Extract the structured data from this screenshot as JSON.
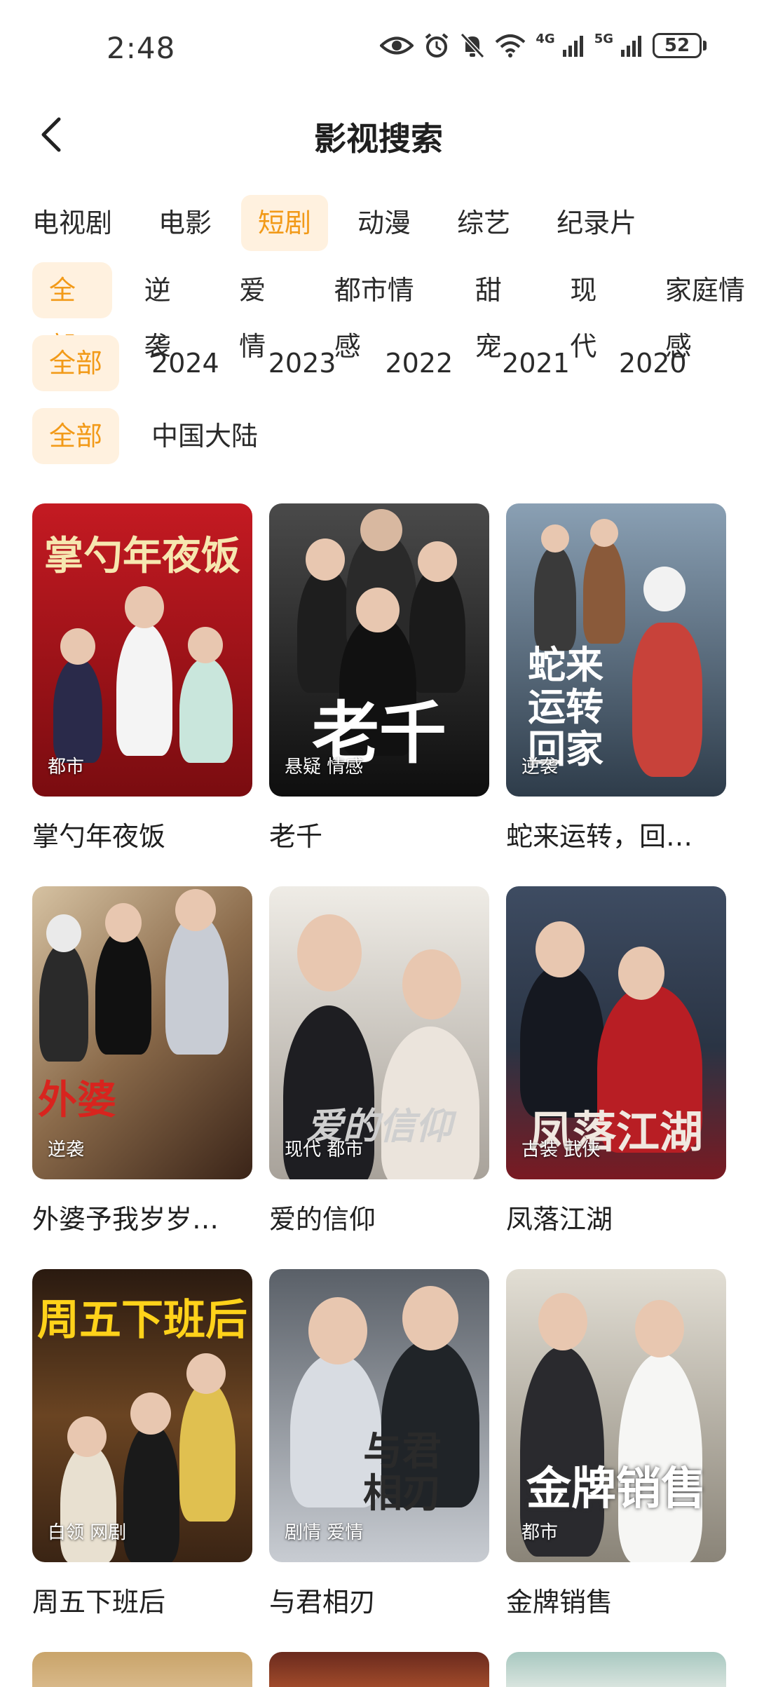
{
  "status": {
    "time": "2:48",
    "battery": "52",
    "net1": "4G",
    "net2": "5G"
  },
  "header": {
    "title": "影视搜索"
  },
  "categories": [
    "电视剧",
    "电影",
    "短剧",
    "动漫",
    "综艺",
    "纪录片"
  ],
  "active_category": "短剧",
  "filters": {
    "genre": [
      "全部",
      "逆袭",
      "爱情",
      "都市情感",
      "甜宠",
      "现代",
      "家庭情感"
    ],
    "year": [
      "全部",
      "2024",
      "2023",
      "2022",
      "2021",
      "2020"
    ],
    "region": [
      "全部",
      "中国大陆"
    ]
  },
  "items": [
    {
      "title": "掌勺年夜饭",
      "tag": "都市",
      "poster_text": "掌勺年夜饭",
      "color_top": "#b8151c",
      "color_bottom": "#6b0a0c"
    },
    {
      "title": "老千",
      "tag": "悬疑 情感",
      "poster_text": "老千",
      "color_top": "#3b3b3b",
      "color_bottom": "#101010"
    },
    {
      "title": "蛇来运转，回…",
      "tag": "逆袭",
      "poster_text": "蛇来运转回家",
      "color_top": "#7a8da0",
      "color_bottom": "#3a4a5a"
    },
    {
      "title": "外婆予我岁岁…",
      "tag": "逆袭",
      "poster_text": "外婆",
      "color_top": "#8a6a4a",
      "color_bottom": "#4a2a1a"
    },
    {
      "title": "爱的信仰",
      "tag": "现代 都市",
      "poster_text": "爱的信仰",
      "color_top": "#e6e2dc",
      "color_bottom": "#9a948c"
    },
    {
      "title": "凤落江湖",
      "tag": "古装 武侠",
      "poster_text": "凤落江湖",
      "color_top": "#4a5a70",
      "color_bottom": "#7a1a20"
    },
    {
      "title": "周五下班后",
      "tag": "白领 网剧",
      "poster_text": "周五下班后",
      "color_top": "#3a2414",
      "color_bottom": "#8a5a2a"
    },
    {
      "title": "与君相刃",
      "tag": "剧情 爱情",
      "poster_text": "与君相刃",
      "color_top": "#6a7078",
      "color_bottom": "#c8ccd0"
    },
    {
      "title": "金牌销售",
      "tag": "都市",
      "poster_text": "金牌销售",
      "color_top": "#d8d4c8",
      "color_bottom": "#8a8478"
    }
  ]
}
